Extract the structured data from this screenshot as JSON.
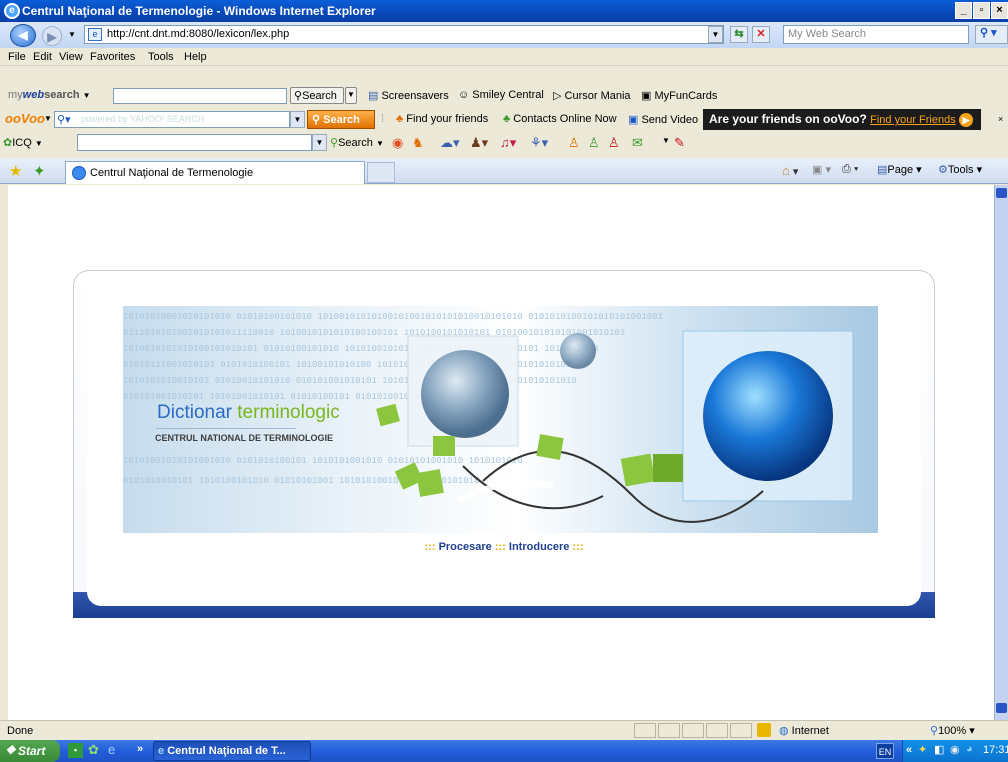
{
  "window": {
    "title": "Centrul Naţional de Termenologie - Windows Internet Explorer"
  },
  "address_bar": {
    "url": "http://cnt.dnt.md:8080/lexicon/lex.php",
    "search_placeholder": "My Web Search"
  },
  "menu": [
    "File",
    "Edit",
    "View",
    "Favorites",
    "Tools",
    "Help"
  ],
  "mywebsearch_bar": {
    "brand_my": "my",
    "brand_web": "web",
    "brand_search": "search",
    "search_button": "Search",
    "items": [
      "Screensavers",
      "Smiley Central",
      "Cursor Mania",
      "MyFunCards"
    ]
  },
  "oovoo_bar": {
    "brand": "ooVoo",
    "yahoo_placeholder": "powered by YAHOO! SEARCH",
    "search_button": "Search",
    "items": [
      "Find your friends",
      "Contacts Online Now",
      "Send Video"
    ],
    "promo_text": "Are your friends on ooVoo?",
    "promo_link": "Find your Friends"
  },
  "icq_bar": {
    "label": "ICQ",
    "search_label": "Search"
  },
  "tab": {
    "title": "Centrul Naţional de Termenologie"
  },
  "command_bar": {
    "page": "Page",
    "tools": "Tools"
  },
  "banner": {
    "title_word1": "Dictionar",
    "title_word2": "terminologic",
    "subtitle": "CENTRUL NATIONAL DE TERMINOLOGIE"
  },
  "page_links": {
    "sep": ":::",
    "items": [
      "Procesare",
      "Introducere"
    ]
  },
  "status": {
    "text": "Done",
    "zone": "Internet",
    "zoom": "100%"
  },
  "taskbar": {
    "start": "Start",
    "task": "Centrul Naţional de T...",
    "lang": "EN",
    "clock": "17:31"
  },
  "colors": {
    "title_blue": "#2b6bc2",
    "title_green": "#7ab51d",
    "link_blue": "#1f3f8f",
    "link_sep": "#e3a600"
  }
}
